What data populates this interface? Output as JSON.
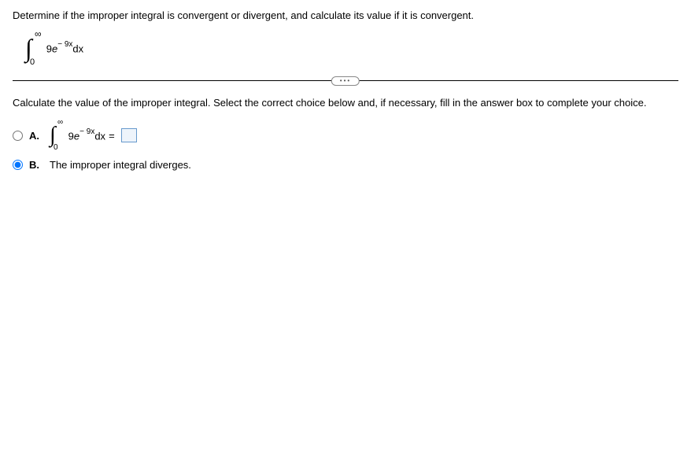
{
  "question": "Determine if the improper integral is convergent or divergent, and calculate its value if it is convergent.",
  "integral": {
    "upper": "∞",
    "lower": "0",
    "coefficient": "9",
    "base": "e",
    "exponent": "− 9x",
    "differential": "dx"
  },
  "instruction": "Calculate the value of the improper integral. Select the correct choice below and, if necessary, fill in the answer box to complete your choice.",
  "choices": {
    "a": {
      "label": "A.",
      "equals": "=",
      "selected": false
    },
    "b": {
      "label": "B.",
      "text": "The improper integral diverges.",
      "selected": true
    }
  },
  "ellipsis": "•••"
}
